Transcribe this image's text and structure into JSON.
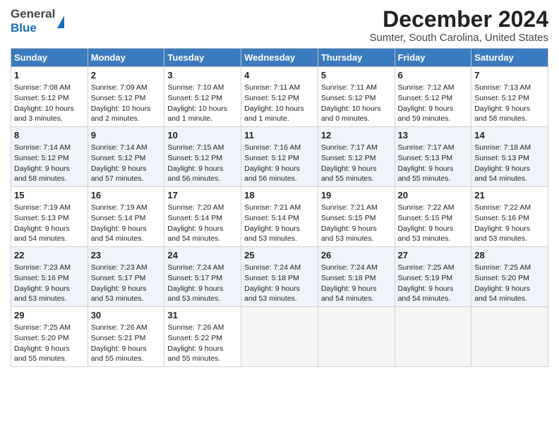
{
  "header": {
    "logo_general": "General",
    "logo_blue": "Blue",
    "title": "December 2024",
    "subtitle": "Sumter, South Carolina, United States"
  },
  "columns": [
    "Sunday",
    "Monday",
    "Tuesday",
    "Wednesday",
    "Thursday",
    "Friday",
    "Saturday"
  ],
  "weeks": [
    [
      {
        "day": "1",
        "lines": [
          "Sunrise: 7:08 AM",
          "Sunset: 5:12 PM",
          "Daylight: 10 hours",
          "and 3 minutes."
        ]
      },
      {
        "day": "2",
        "lines": [
          "Sunrise: 7:09 AM",
          "Sunset: 5:12 PM",
          "Daylight: 10 hours",
          "and 2 minutes."
        ]
      },
      {
        "day": "3",
        "lines": [
          "Sunrise: 7:10 AM",
          "Sunset: 5:12 PM",
          "Daylight: 10 hours",
          "and 1 minute."
        ]
      },
      {
        "day": "4",
        "lines": [
          "Sunrise: 7:11 AM",
          "Sunset: 5:12 PM",
          "Daylight: 10 hours",
          "and 1 minute."
        ]
      },
      {
        "day": "5",
        "lines": [
          "Sunrise: 7:11 AM",
          "Sunset: 5:12 PM",
          "Daylight: 10 hours",
          "and 0 minutes."
        ]
      },
      {
        "day": "6",
        "lines": [
          "Sunrise: 7:12 AM",
          "Sunset: 5:12 PM",
          "Daylight: 9 hours",
          "and 59 minutes."
        ]
      },
      {
        "day": "7",
        "lines": [
          "Sunrise: 7:13 AM",
          "Sunset: 5:12 PM",
          "Daylight: 9 hours",
          "and 58 minutes."
        ]
      }
    ],
    [
      {
        "day": "8",
        "lines": [
          "Sunrise: 7:14 AM",
          "Sunset: 5:12 PM",
          "Daylight: 9 hours",
          "and 58 minutes."
        ]
      },
      {
        "day": "9",
        "lines": [
          "Sunrise: 7:14 AM",
          "Sunset: 5:12 PM",
          "Daylight: 9 hours",
          "and 57 minutes."
        ]
      },
      {
        "day": "10",
        "lines": [
          "Sunrise: 7:15 AM",
          "Sunset: 5:12 PM",
          "Daylight: 9 hours",
          "and 56 minutes."
        ]
      },
      {
        "day": "11",
        "lines": [
          "Sunrise: 7:16 AM",
          "Sunset: 5:12 PM",
          "Daylight: 9 hours",
          "and 56 minutes."
        ]
      },
      {
        "day": "12",
        "lines": [
          "Sunrise: 7:17 AM",
          "Sunset: 5:12 PM",
          "Daylight: 9 hours",
          "and 55 minutes."
        ]
      },
      {
        "day": "13",
        "lines": [
          "Sunrise: 7:17 AM",
          "Sunset: 5:13 PM",
          "Daylight: 9 hours",
          "and 55 minutes."
        ]
      },
      {
        "day": "14",
        "lines": [
          "Sunrise: 7:18 AM",
          "Sunset: 5:13 PM",
          "Daylight: 9 hours",
          "and 54 minutes."
        ]
      }
    ],
    [
      {
        "day": "15",
        "lines": [
          "Sunrise: 7:19 AM",
          "Sunset: 5:13 PM",
          "Daylight: 9 hours",
          "and 54 minutes."
        ]
      },
      {
        "day": "16",
        "lines": [
          "Sunrise: 7:19 AM",
          "Sunset: 5:14 PM",
          "Daylight: 9 hours",
          "and 54 minutes."
        ]
      },
      {
        "day": "17",
        "lines": [
          "Sunrise: 7:20 AM",
          "Sunset: 5:14 PM",
          "Daylight: 9 hours",
          "and 54 minutes."
        ]
      },
      {
        "day": "18",
        "lines": [
          "Sunrise: 7:21 AM",
          "Sunset: 5:14 PM",
          "Daylight: 9 hours",
          "and 53 minutes."
        ]
      },
      {
        "day": "19",
        "lines": [
          "Sunrise: 7:21 AM",
          "Sunset: 5:15 PM",
          "Daylight: 9 hours",
          "and 53 minutes."
        ]
      },
      {
        "day": "20",
        "lines": [
          "Sunrise: 7:22 AM",
          "Sunset: 5:15 PM",
          "Daylight: 9 hours",
          "and 53 minutes."
        ]
      },
      {
        "day": "21",
        "lines": [
          "Sunrise: 7:22 AM",
          "Sunset: 5:16 PM",
          "Daylight: 9 hours",
          "and 53 minutes."
        ]
      }
    ],
    [
      {
        "day": "22",
        "lines": [
          "Sunrise: 7:23 AM",
          "Sunset: 5:16 PM",
          "Daylight: 9 hours",
          "and 53 minutes."
        ]
      },
      {
        "day": "23",
        "lines": [
          "Sunrise: 7:23 AM",
          "Sunset: 5:17 PM",
          "Daylight: 9 hours",
          "and 53 minutes."
        ]
      },
      {
        "day": "24",
        "lines": [
          "Sunrise: 7:24 AM",
          "Sunset: 5:17 PM",
          "Daylight: 9 hours",
          "and 53 minutes."
        ]
      },
      {
        "day": "25",
        "lines": [
          "Sunrise: 7:24 AM",
          "Sunset: 5:18 PM",
          "Daylight: 9 hours",
          "and 53 minutes."
        ]
      },
      {
        "day": "26",
        "lines": [
          "Sunrise: 7:24 AM",
          "Sunset: 5:18 PM",
          "Daylight: 9 hours",
          "and 54 minutes."
        ]
      },
      {
        "day": "27",
        "lines": [
          "Sunrise: 7:25 AM",
          "Sunset: 5:19 PM",
          "Daylight: 9 hours",
          "and 54 minutes."
        ]
      },
      {
        "day": "28",
        "lines": [
          "Sunrise: 7:25 AM",
          "Sunset: 5:20 PM",
          "Daylight: 9 hours",
          "and 54 minutes."
        ]
      }
    ],
    [
      {
        "day": "29",
        "lines": [
          "Sunrise: 7:25 AM",
          "Sunset: 5:20 PM",
          "Daylight: 9 hours",
          "and 55 minutes."
        ]
      },
      {
        "day": "30",
        "lines": [
          "Sunrise: 7:26 AM",
          "Sunset: 5:21 PM",
          "Daylight: 9 hours",
          "and 55 minutes."
        ]
      },
      {
        "day": "31",
        "lines": [
          "Sunrise: 7:26 AM",
          "Sunset: 5:22 PM",
          "Daylight: 9 hours",
          "and 55 minutes."
        ]
      },
      {
        "day": "",
        "lines": []
      },
      {
        "day": "",
        "lines": []
      },
      {
        "day": "",
        "lines": []
      },
      {
        "day": "",
        "lines": []
      }
    ]
  ]
}
